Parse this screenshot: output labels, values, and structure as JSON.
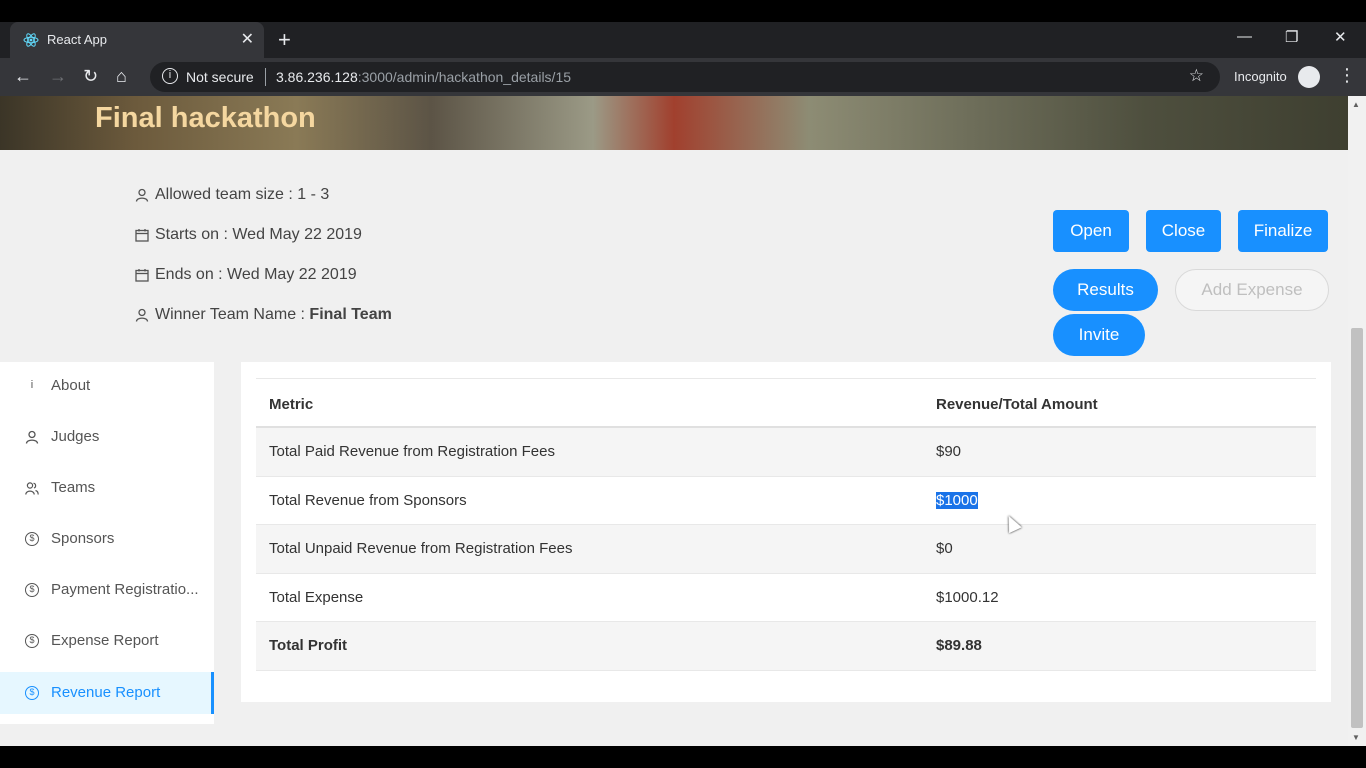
{
  "browser": {
    "tab_title": "React App",
    "tab_close": "✕",
    "new_tab": "+",
    "url_security": "Not secure",
    "url_host": "3.86.236.128",
    "url_path": ":3000/admin/hackathon_details/15",
    "incognito_label": "Incognito",
    "win_min": "—",
    "win_restore": "❐",
    "win_close": "✕"
  },
  "hackathon": {
    "title": "Final hackathon",
    "team_size": "Allowed team size : 1 - 3",
    "starts_on": "Starts on : Wed May 22 2019",
    "ends_on": "Ends on : Wed May 22 2019",
    "winner_prefix": "Winner Team Name : ",
    "winner_name": "Final Team"
  },
  "actions": {
    "open": "Open",
    "close": "Close",
    "finalize": "Finalize",
    "results": "Results",
    "add_expense": "Add Expense",
    "invite": "Invite"
  },
  "sidebar": {
    "items": [
      {
        "label": "About",
        "icon": "i"
      },
      {
        "label": "Judges",
        "icon": "user-icon"
      },
      {
        "label": "Teams",
        "icon": "team-icon"
      },
      {
        "label": "Sponsors",
        "icon": "dollar-icon"
      },
      {
        "label": "Payment Registratio...",
        "icon": "dollar-icon"
      },
      {
        "label": "Expense Report",
        "icon": "dollar-icon"
      },
      {
        "label": "Revenue Report",
        "icon": "dollar-icon",
        "active": true
      }
    ]
  },
  "table": {
    "headers": [
      "Metric",
      "Revenue/Total Amount"
    ],
    "rows": [
      {
        "metric": "Total Paid Revenue from Registration Fees",
        "amount": "$90"
      },
      {
        "metric": "Total Revenue from Sponsors",
        "amount": "$1000"
      },
      {
        "metric": "Total Unpaid Revenue from Registration Fees",
        "amount": "$0"
      },
      {
        "metric": "Total Expense",
        "amount": "$1000.12"
      },
      {
        "metric": "Total Profit",
        "amount": "$89.88"
      }
    ]
  },
  "colors": {
    "primary": "#1890ff",
    "selection": "#1a73e8"
  }
}
